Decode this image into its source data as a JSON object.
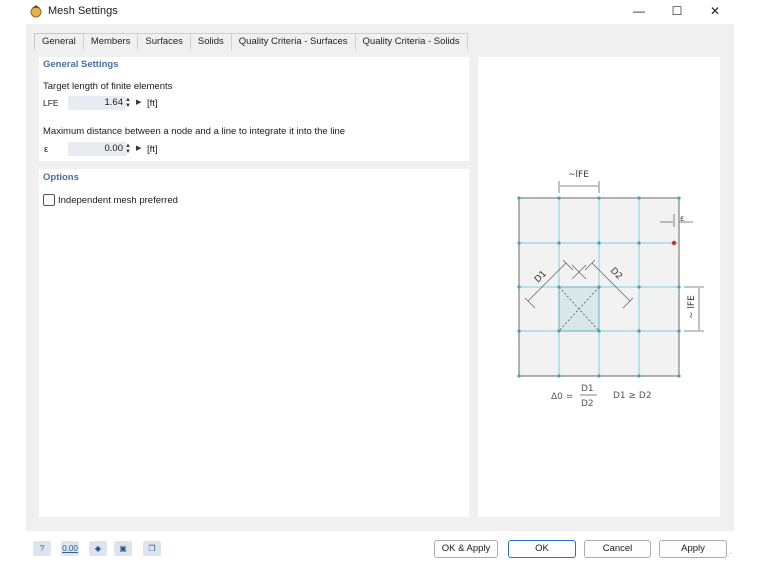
{
  "window": {
    "title": "Mesh Settings",
    "minimize": "—",
    "maximize": "☐",
    "close": "✕"
  },
  "tabs": [
    "General",
    "Members",
    "Surfaces",
    "Solids",
    "Quality Criteria - Surfaces",
    "Quality Criteria - Solids"
  ],
  "active_tab": "General",
  "general": {
    "section_title": "General Settings",
    "target_label": "Target length of finite elements",
    "lfe_symbol": "LFE",
    "lfe_value": "1.64",
    "lfe_unit": "[ft]",
    "maxdist_label": "Maximum distance between a node and a line to integrate it into the line",
    "eps_symbol": "ε",
    "eps_value": "0.00",
    "eps_unit": "[ft]"
  },
  "options": {
    "section_title": "Options",
    "independent_mesh_label": "Independent mesh preferred",
    "independent_mesh_checked": false
  },
  "diagram": {
    "lfe_top": "~lFE",
    "lfe_right": "~ lFE",
    "eps": "ε",
    "d1": "D1",
    "d2": "D2",
    "delta": "Δ0 =",
    "frac_num": "D1",
    "frac_den": "D2",
    "cond": "D1 ≥ D2"
  },
  "footer": {
    "icons": [
      "help-icon",
      "units-icon",
      "model-icon",
      "save-icon",
      "copy-icon"
    ],
    "units_glyph": "0.00",
    "ok_apply": "OK & Apply",
    "ok": "OK",
    "cancel": "Cancel",
    "apply": "Apply"
  }
}
